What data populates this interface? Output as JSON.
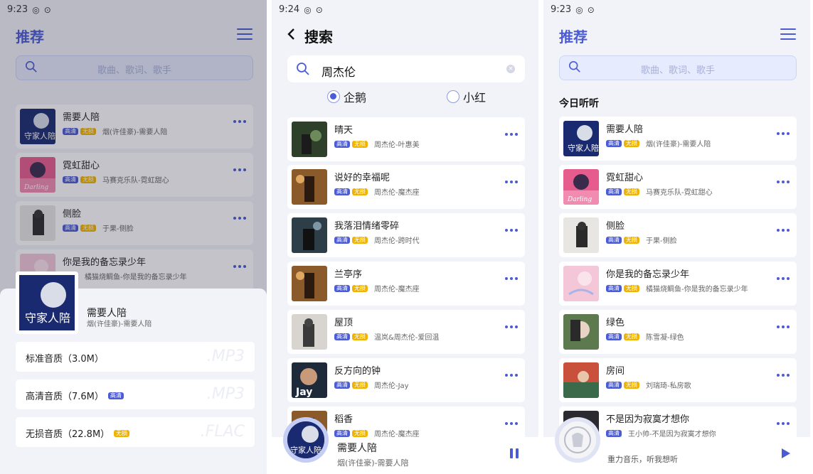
{
  "status": {
    "s1_time": "9:23",
    "s2_time": "9:24",
    "s3_time": "9:23"
  },
  "recommend": {
    "title": "推荐",
    "search_placeholder": "歌曲、歌词、歌手",
    "section_title": "今日听听"
  },
  "tags": {
    "hq": "高清",
    "lossless": "无损"
  },
  "s1_songs": [
    {
      "title": "需要人陪",
      "artist": "烟(许佳豪)-需要人陪",
      "tags": [
        "hq",
        "ls"
      ]
    },
    {
      "title": "霓虹甜心",
      "artist": "马赛克乐队-霓虹甜心",
      "tags": [
        "hq",
        "ls"
      ]
    },
    {
      "title": "侧脸",
      "artist": "于果-侧脸",
      "tags": [
        "hq",
        "ls"
      ]
    },
    {
      "title": "你是我的备忘录少年",
      "artist": "橘猫烧鲷鱼-你是我的备忘录少年",
      "tags": [
        "hq"
      ]
    }
  ],
  "quality_sheet": {
    "song_title": "需要人陪",
    "song_sub": "烟(许佳豪)-需要人陪",
    "options": [
      {
        "label": "标准音质（3.0M）",
        "badge": "",
        "format": ".MP3"
      },
      {
        "label": "高清音质（7.6M）",
        "badge": "高清",
        "format": ".MP3"
      },
      {
        "label": "无损音质（22.8M）",
        "badge": "无损",
        "format": ".FLAC"
      }
    ]
  },
  "search_page": {
    "title": "搜索",
    "query": "周杰伦",
    "source_options": [
      {
        "label": "企鹅",
        "selected": true
      },
      {
        "label": "小红",
        "selected": false
      }
    ],
    "results": [
      {
        "title": "晴天",
        "artist": "周杰伦-叶惠美"
      },
      {
        "title": "说好的幸福呢",
        "artist": "周杰伦-魔杰座"
      },
      {
        "title": "我落泪情绪零碎",
        "artist": "周杰伦-跨时代"
      },
      {
        "title": "兰亭序",
        "artist": "周杰伦-魔杰座"
      },
      {
        "title": "屋顶",
        "artist": "温岚&周杰伦-爱回温"
      },
      {
        "title": "反方向的钟",
        "artist": "周杰伦-Jay"
      },
      {
        "title": "稻香",
        "artist": "周杰伦-魔杰座"
      }
    ],
    "player": {
      "title": "需要人陪",
      "sub": "烟(许佳豪)-需要人陪",
      "state": "playing"
    }
  },
  "s3_songs": [
    {
      "title": "需要人陪",
      "artist": "烟(许佳豪)-需要人陪",
      "tags": [
        "hq",
        "ls"
      ]
    },
    {
      "title": "霓虹甜心",
      "artist": "马赛克乐队-霓虹甜心",
      "tags": [
        "hq",
        "ls"
      ]
    },
    {
      "title": "侧脸",
      "artist": "于果-侧脸",
      "tags": [
        "hq",
        "ls"
      ]
    },
    {
      "title": "你是我的备忘录少年",
      "artist": "橘猫烧鲷鱼-你是我的备忘录少年",
      "tags": [
        "hq",
        "ls"
      ]
    },
    {
      "title": "绿色",
      "artist": "陈雪凝-绿色",
      "tags": [
        "hq",
        "ls"
      ]
    },
    {
      "title": "房间",
      "artist": "刘瑞琦-私房歌",
      "tags": [
        "hq",
        "ls"
      ]
    },
    {
      "title": "不是因为寂寞才想你",
      "artist": "王小帅-不是因为寂寞才想你",
      "tags": [
        "hq"
      ]
    }
  ],
  "s3_player": {
    "tagline": "重力音乐，听我想听",
    "state": "paused"
  },
  "colors": {
    "accent": "#4a5bd4",
    "lossless": "#f0b400",
    "bg": "#f2f3f9"
  }
}
